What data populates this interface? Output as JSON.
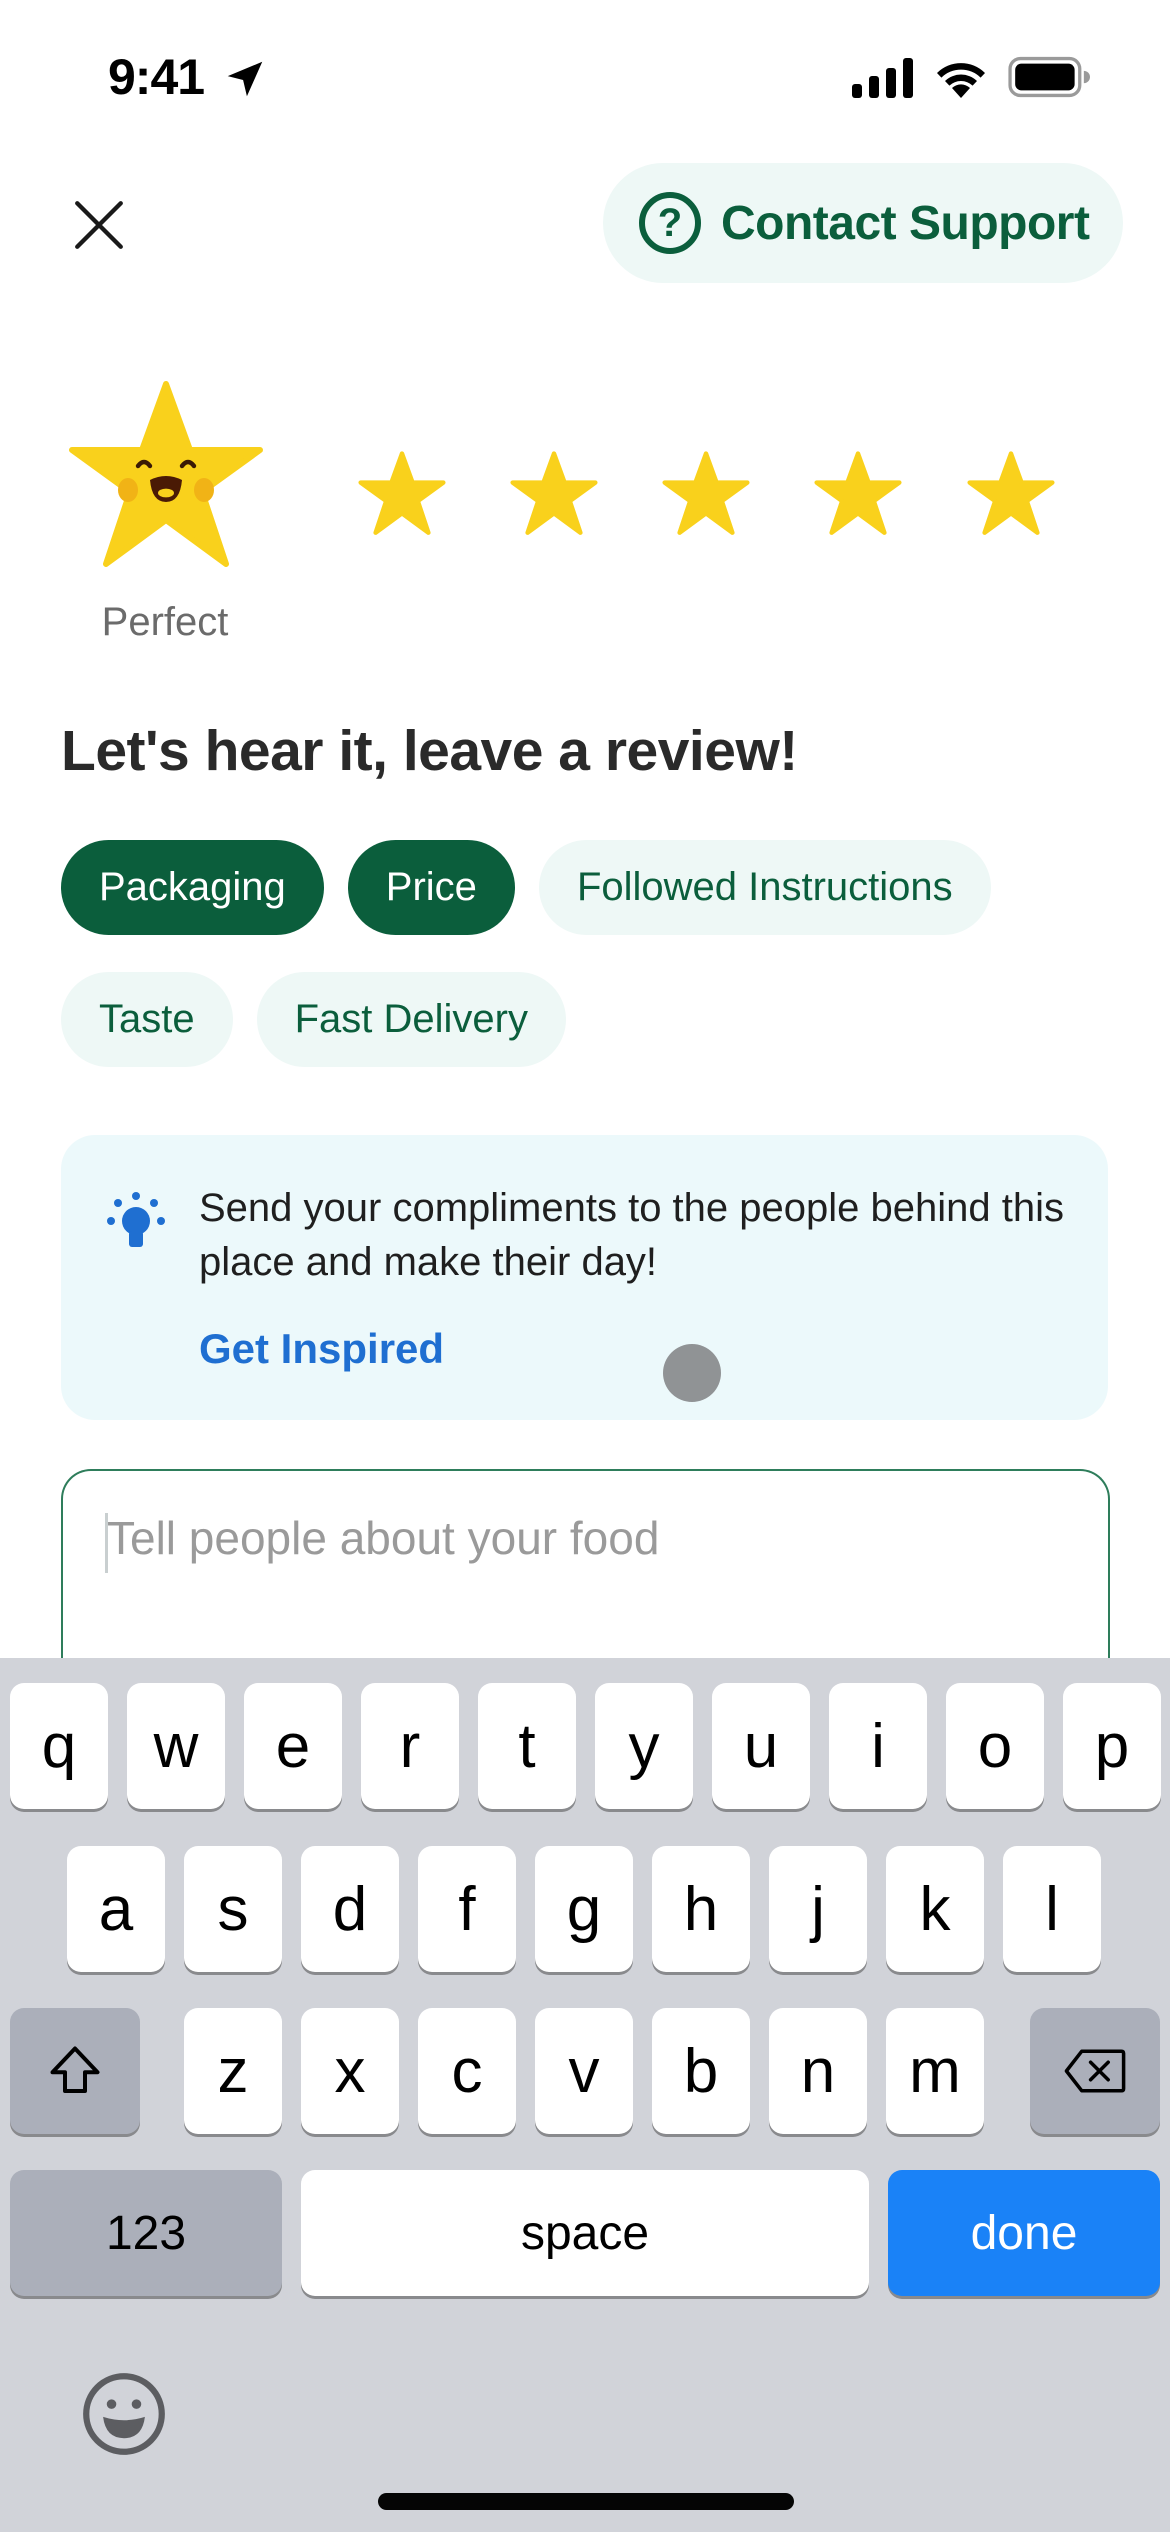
{
  "status_bar": {
    "time": "9:41"
  },
  "header": {
    "contact_support_label": "Contact Support"
  },
  "rating": {
    "selected_stars": 5,
    "max_stars": 5,
    "label": "Perfect",
    "star_color": "#F9D11C"
  },
  "review": {
    "heading": "Let's hear it, leave a review!",
    "tags": [
      {
        "label": "Packaging",
        "selected": true
      },
      {
        "label": "Price",
        "selected": true
      },
      {
        "label": "Followed Instructions",
        "selected": false
      },
      {
        "label": "Taste",
        "selected": false
      },
      {
        "label": "Fast Delivery",
        "selected": false
      }
    ],
    "tip_text": "Send your compliments to the people behind this place and make their day!",
    "tip_link": "Get Inspired",
    "input_value": "",
    "input_placeholder": "Tell people about your food"
  },
  "keyboard": {
    "row1": [
      "q",
      "w",
      "e",
      "r",
      "t",
      "y",
      "u",
      "i",
      "o",
      "p"
    ],
    "row2": [
      "a",
      "s",
      "d",
      "f",
      "g",
      "h",
      "j",
      "k",
      "l"
    ],
    "row3": [
      "z",
      "x",
      "c",
      "v",
      "b",
      "n",
      "m"
    ],
    "numbers_label": "123",
    "space_label": "space",
    "done_label": "done"
  },
  "colors": {
    "brand_green": "#0B5E3C",
    "chip_bg": "#EEF8F6",
    "link_blue": "#1F6FD1",
    "done_blue": "#1A82F7"
  }
}
